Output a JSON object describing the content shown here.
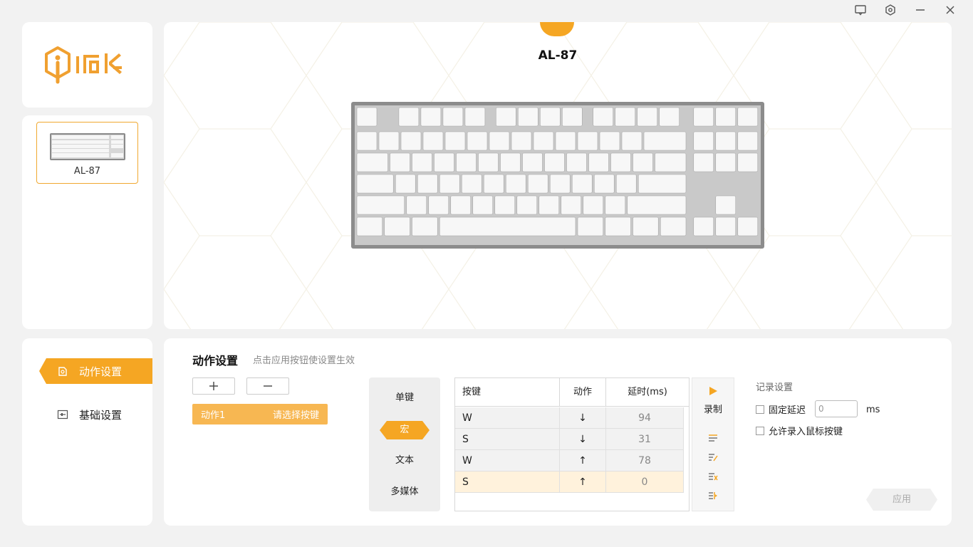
{
  "window": {
    "icons": [
      "feedback-icon",
      "settings-icon",
      "minimize-icon",
      "close-icon"
    ]
  },
  "device": {
    "name": "AL-87",
    "title": "AL-87"
  },
  "nav": {
    "items": [
      {
        "label": "动作设置",
        "active": true,
        "icon": "macro-icon"
      },
      {
        "label": "基础设置",
        "active": false,
        "icon": "basic-settings-icon"
      }
    ]
  },
  "action": {
    "title": "动作设置",
    "hint": "点击应用按钮使设置生效",
    "add_symbol": "+",
    "remove_symbol": "−",
    "list": [
      {
        "name": "动作1",
        "hint": "请选择按键"
      }
    ],
    "types": [
      "单键",
      "宏",
      "文本",
      "多媒体"
    ],
    "active_type": "宏",
    "table": {
      "headers": [
        "按键",
        "动作",
        "延时(ms)"
      ],
      "rows": [
        {
          "key": "W",
          "action": "↓",
          "delay": "94"
        },
        {
          "key": "S",
          "action": "↓",
          "delay": "31"
        },
        {
          "key": "W",
          "action": "↑",
          "delay": "78"
        },
        {
          "key": "S",
          "action": "↑",
          "delay": "0"
        }
      ],
      "selected_row": 3
    },
    "record_label": "录制",
    "record_settings": {
      "title": "记录设置",
      "fixed_delay_label": "固定延迟",
      "fixed_delay_value": "0",
      "unit": "ms",
      "mouse_record_label": "允许录入鼠标按键"
    },
    "apply_label": "应用"
  },
  "colors": {
    "accent": "#f5a623",
    "accent_light": "#f7b752",
    "row_selected": "#fff2dc"
  }
}
